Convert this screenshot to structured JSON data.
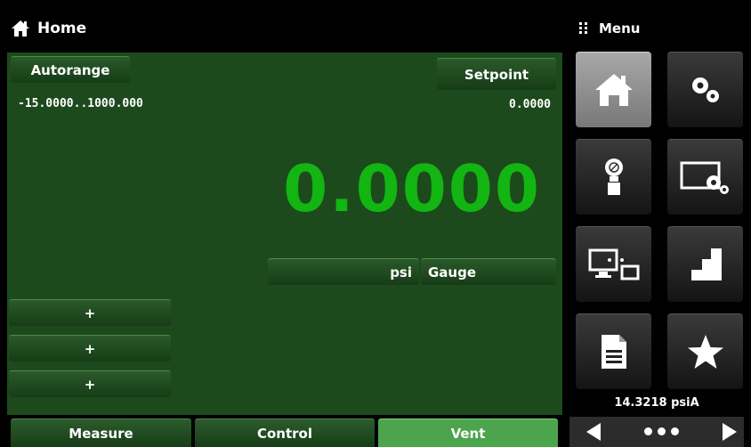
{
  "header": {
    "title": "Home",
    "menu_label": "Menu"
  },
  "main": {
    "autorange_label": "Autorange",
    "range_text": "-15.0000..1000.000",
    "setpoint_label": "Setpoint",
    "setpoint_value": "0.0000",
    "reading": "0.0000",
    "unit": "psi",
    "mode": "Gauge",
    "aux_buttons": [
      "+",
      "+",
      "+"
    ]
  },
  "tabs": [
    {
      "label": "Measure",
      "active": false
    },
    {
      "label": "Control",
      "active": false
    },
    {
      "label": "Vent",
      "active": true
    }
  ],
  "menu_tiles": [
    {
      "icon": "home-icon",
      "active": true
    },
    {
      "icon": "gears-icon",
      "active": false
    },
    {
      "icon": "pressure-sensor-icon",
      "active": false
    },
    {
      "icon": "display-settings-icon",
      "active": false
    },
    {
      "icon": "remote-communication-icon",
      "active": false
    },
    {
      "icon": "step-program-icon",
      "active": false
    },
    {
      "icon": "document-icon",
      "active": false
    },
    {
      "icon": "favorite-star-icon",
      "active": false
    }
  ],
  "status": {
    "barometer": "14.3218 psiA"
  },
  "colors": {
    "panel_bg": "#1d4a1d",
    "reading_green": "#12b512",
    "active_tab": "#4ca54c"
  }
}
